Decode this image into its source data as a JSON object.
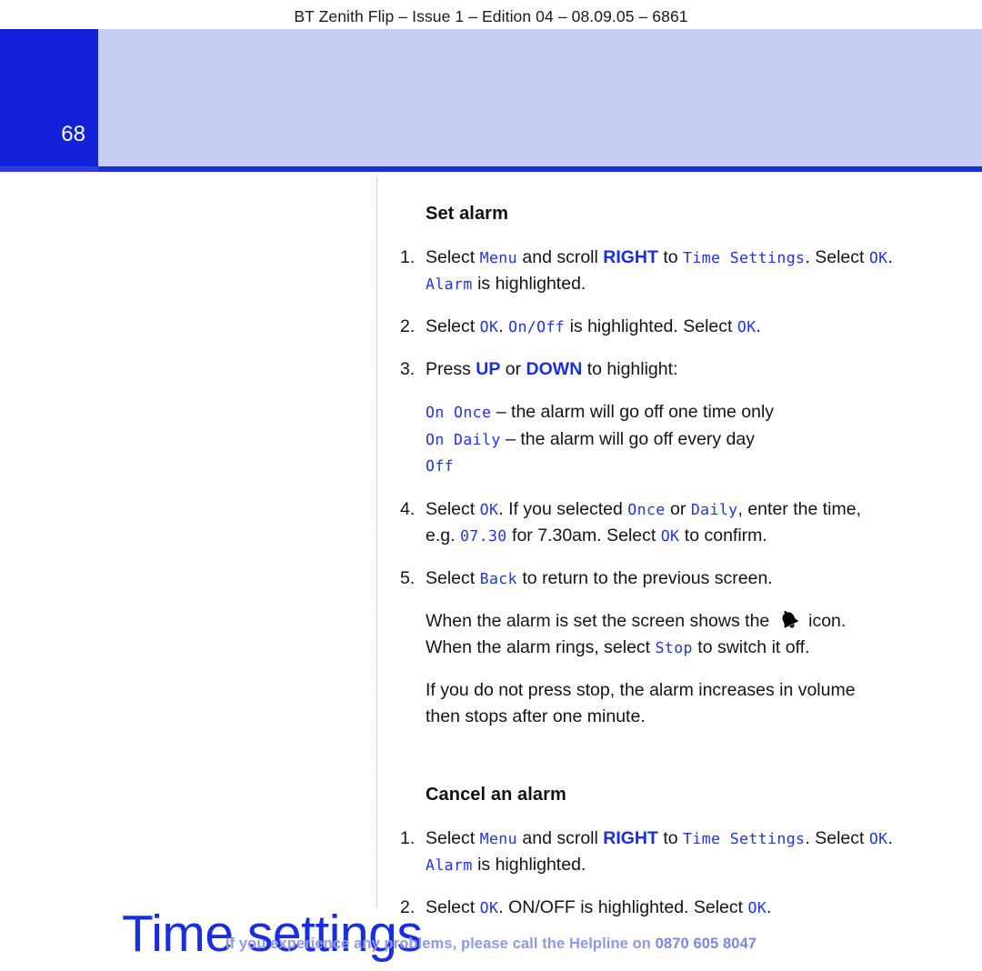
{
  "header": {
    "running_head": "BT Zenith Flip – Issue 1 – Edition 04 – 08.09.05 – 6861"
  },
  "title_band": {
    "page_number": "68",
    "title": "Time settings",
    "band_color": "#c6ccf2",
    "block_color": "#1122d8",
    "title_color": "#1a2ee0",
    "rule_color": "#1a2ee0"
  },
  "sections": [
    {
      "heading": "Set alarm",
      "steps": [
        {
          "marker": "1.",
          "line1_a": "Select ",
          "line1_lcd1": "Menu",
          "line1_b": " and scroll ",
          "line1_key": "RIGHT",
          "line1_c": " to ",
          "line1_lcd2": "Time Settings",
          "line1_d": ". Select ",
          "line1_lcd3": "OK",
          "line1_e": ".",
          "line2_lcd": "Alarm",
          "line2_text": " is highlighted."
        },
        {
          "marker": "2.",
          "line1_a": "Select ",
          "line1_lcd1": "OK",
          "line1_b": ". ",
          "line1_lcd2": "On/Off",
          "line1_c": " is highlighted. Select ",
          "line1_lcd3": "OK",
          "line1_d": "."
        },
        {
          "marker": "3.",
          "line1_a": "Press ",
          "line1_key1": "UP",
          "line1_b": " or ",
          "line1_key2": "DOWN",
          "line1_c": " to highlight:"
        }
      ],
      "options": [
        {
          "lcd": "On Once",
          "text": " – the alarm will go off one time only"
        },
        {
          "lcd": "On Daily",
          "text": " – the alarm will go off every day"
        },
        {
          "lcd": "Off",
          "text": ""
        }
      ],
      "steps2": [
        {
          "marker": "4.",
          "line1_a": "Select ",
          "line1_lcd1": "OK",
          "line1_b": ". If you selected ",
          "line1_lcd2": "Once",
          "line1_c": " or ",
          "line1_lcd3": "Daily",
          "line1_d": ", enter the time,",
          "line2_a": "e.g. ",
          "line2_lcd1": "07.30",
          "line2_b": " for 7.30am. Select ",
          "line2_lcd2": "OK",
          "line2_c": " to confirm."
        },
        {
          "marker": "5.",
          "line1_a": "Select ",
          "line1_lcd1": "Back",
          "line1_b": " to return to the previous screen."
        }
      ],
      "paragraphs": [
        {
          "line1_a": "When the alarm is set the screen shows the ",
          "icon": "alarm-bell-icon",
          "line1_b": " icon.",
          "line2_a": "When the alarm rings, select ",
          "line2_lcd": "Stop",
          "line2_b": " to switch it off."
        },
        {
          "line1_a": "If you do not press stop, the alarm increases in volume",
          "line2_a": "then stops after one minute."
        }
      ]
    },
    {
      "heading": "Cancel an alarm",
      "steps": [
        {
          "marker": "1.",
          "line1_a": "Select ",
          "line1_lcd1": "Menu",
          "line1_b": " and scroll ",
          "line1_key": "RIGHT",
          "line1_c": " to ",
          "line1_lcd2": "Time Settings",
          "line1_d": ". Select ",
          "line1_lcd3": "OK",
          "line1_e": ".",
          "line2_lcd": "Alarm",
          "line2_text": " is highlighted."
        },
        {
          "marker": "2.",
          "line1_a": "Select ",
          "line1_lcd1": "OK",
          "line1_b": ". ON/OFF is highlighted. Select ",
          "line1_lcd3": "OK",
          "line1_d": "."
        }
      ]
    }
  ],
  "footer": {
    "text": "If you experience any problems, please call the Helpline on ",
    "phone": "0870 605 8047",
    "color": "#8e9ae8"
  }
}
